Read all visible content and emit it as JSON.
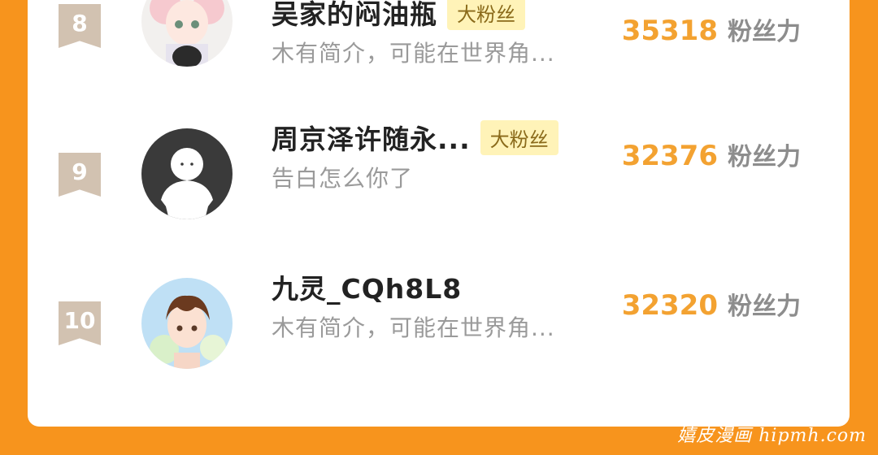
{
  "leaderboard": {
    "unit_label": "粉丝力",
    "rows": [
      {
        "rank": "8",
        "name": "吴家的闷油瓶",
        "badge": "大粉丝",
        "bio": "木有简介，可能在世界角...",
        "score": "35318",
        "avatar": "anime-girl-avatar"
      },
      {
        "rank": "9",
        "name": "周京泽许随永...",
        "badge": "大粉丝",
        "bio": "告白怎么你了",
        "score": "32376",
        "avatar": "default-person-avatar"
      },
      {
        "rank": "10",
        "name": "九灵_CQh8L8",
        "badge": "",
        "bio": "木有简介，可能在世界角...",
        "score": "32320",
        "avatar": "anime-boy-avatar"
      }
    ]
  },
  "watermark": "嬉皮漫画 hipmh.com",
  "colors": {
    "page_background": "#f7941d",
    "score": "#f3a231",
    "badge_background": "#fff3b8",
    "rank_badge": "#d2c2b1"
  }
}
